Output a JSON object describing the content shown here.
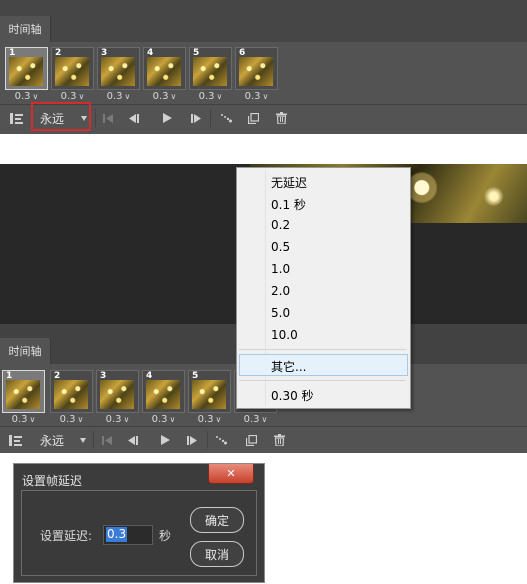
{
  "top_panel": {
    "tab": "时间轴",
    "frames": [
      {
        "number": "1",
        "delay": "0.3"
      },
      {
        "number": "2",
        "delay": "0.3"
      },
      {
        "number": "3",
        "delay": "0.3"
      },
      {
        "number": "4",
        "delay": "0.3"
      },
      {
        "number": "5",
        "delay": "0.3"
      },
      {
        "number": "6",
        "delay": "0.3"
      }
    ],
    "loop_label": "永远"
  },
  "bottom_panel": {
    "tab": "时间轴",
    "frames": [
      {
        "number": "1",
        "delay": "0.3"
      },
      {
        "number": "2",
        "delay": "0.3"
      },
      {
        "number": "3",
        "delay": "0.3"
      },
      {
        "number": "4",
        "delay": "0.3"
      },
      {
        "number": "5",
        "delay": "0.3"
      },
      {
        "number": "",
        "delay": "0.3"
      }
    ],
    "loop_label": "永远"
  },
  "delay_menu": {
    "items": [
      "无延迟",
      "0.1 秒",
      "0.2",
      "0.5",
      "1.0",
      "2.0",
      "5.0",
      "10.0"
    ],
    "other": "其它...",
    "current": "0.30 秒"
  },
  "dialog": {
    "title": "设置帧延迟",
    "label": "设置延迟:",
    "value": "0.3",
    "unit": "秒",
    "ok": "确定",
    "cancel": "取消",
    "close": "✕"
  },
  "colors": {
    "panel_bg": "#535353",
    "highlight_box": "#d42b2b",
    "input_selection": "#3b7bd8"
  },
  "icons": [
    "layers-convert-icon",
    "first-frame-icon",
    "prev-frame-icon",
    "play-icon",
    "next-frame-icon",
    "tween-icon",
    "duplicate-frame-icon",
    "trash-icon",
    "chevron-down-icon",
    "close-icon"
  ]
}
